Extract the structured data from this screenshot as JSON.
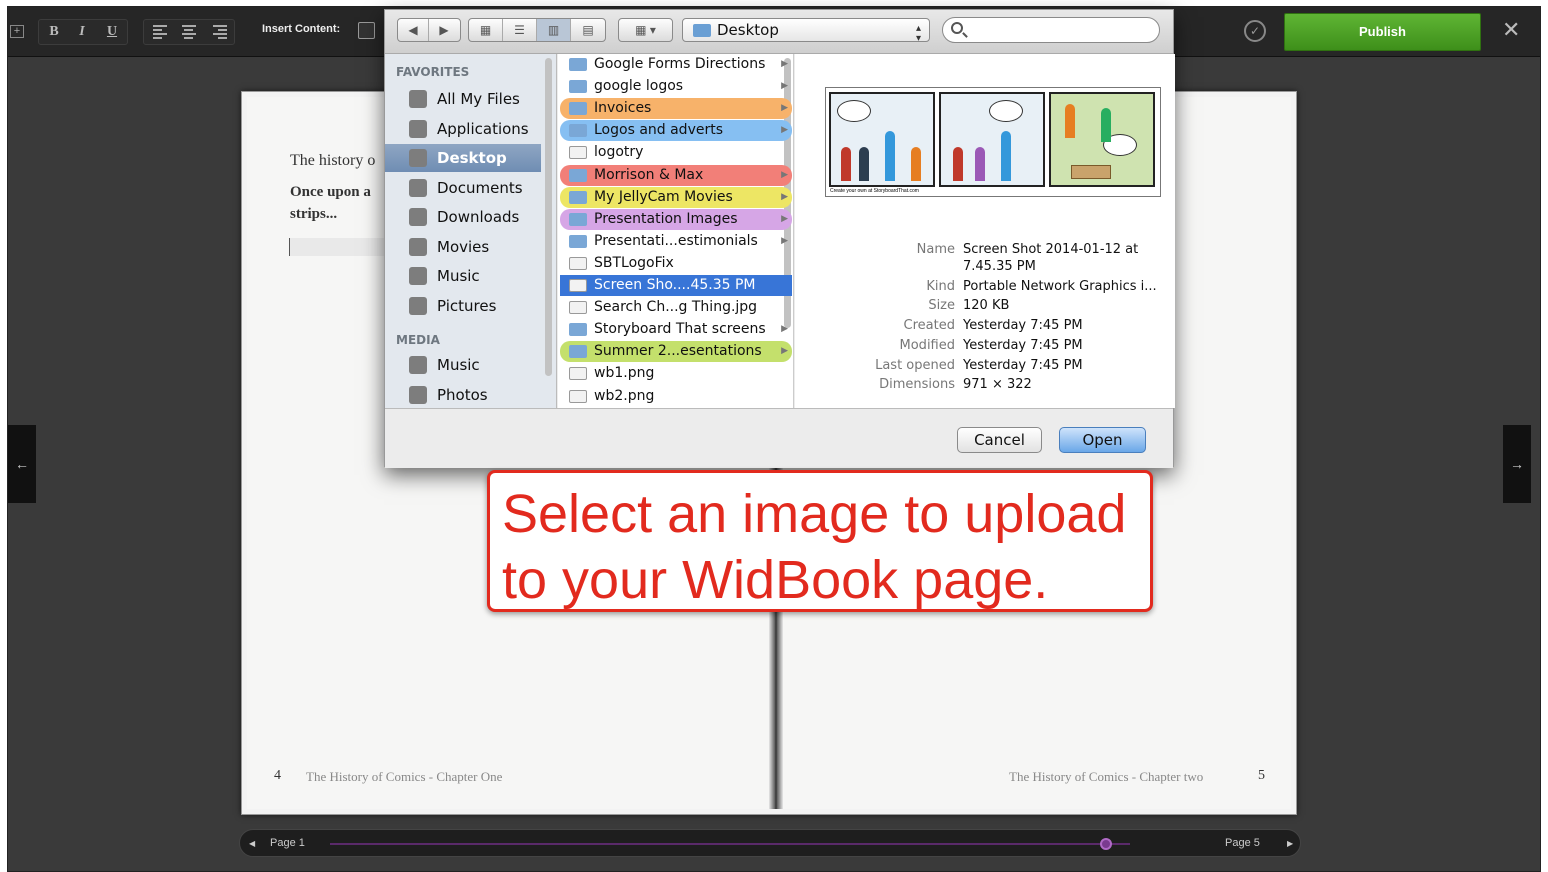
{
  "toolbar": {
    "bold": "B",
    "italic": "I",
    "underline": "U",
    "insert_content_label": "Insert Content:",
    "publish_label": "Publish",
    "close_glyph": "✕",
    "check_glyph": "✓"
  },
  "book": {
    "left_page": {
      "title_partial": "The history o",
      "body_line1": "Once upon a",
      "body_line2": "strips...",
      "page_number": "4",
      "footer": "The History of Comics - Chapter One"
    },
    "right_page": {
      "page_number": "5",
      "footer": "The History of Comics - Chapter two"
    }
  },
  "nav": {
    "prev_glyph": "←",
    "next_glyph": "→"
  },
  "progress": {
    "start_label": "Page 1",
    "end_label": "Page 5",
    "position": 0.97
  },
  "dialog": {
    "location": "Desktop",
    "sidebar": {
      "favorites_header": "FAVORITES",
      "favorites": [
        {
          "label": "All My Files",
          "icon": "all-files-icon"
        },
        {
          "label": "Applications",
          "icon": "applications-icon"
        },
        {
          "label": "Desktop",
          "icon": "desktop-icon",
          "selected": true
        },
        {
          "label": "Documents",
          "icon": "documents-icon"
        },
        {
          "label": "Downloads",
          "icon": "downloads-icon"
        },
        {
          "label": "Movies",
          "icon": "movies-icon"
        },
        {
          "label": "Music",
          "icon": "music-icon"
        },
        {
          "label": "Pictures",
          "icon": "pictures-icon"
        }
      ],
      "media_header": "MEDIA",
      "media": [
        {
          "label": "Music",
          "icon": "music-icon"
        },
        {
          "label": "Photos",
          "icon": "photos-icon"
        }
      ]
    },
    "files": [
      {
        "name": "Google Forms Directions",
        "kind": "folder",
        "tag": "",
        "has_children": true
      },
      {
        "name": "google logos",
        "kind": "folder",
        "tag": "",
        "has_children": true
      },
      {
        "name": "Invoices",
        "kind": "folder",
        "tag": "#f7b26a",
        "has_children": true
      },
      {
        "name": "Logos and adverts",
        "kind": "folder",
        "tag": "#86bff2",
        "has_children": true
      },
      {
        "name": "logotry",
        "kind": "file",
        "tag": "",
        "has_children": false
      },
      {
        "name": "Morrison & Max",
        "kind": "folder",
        "tag": "#f27f78",
        "has_children": true
      },
      {
        "name": "My JellyCam Movies",
        "kind": "folder",
        "tag": "#ede664",
        "has_children": true
      },
      {
        "name": "Presentation Images",
        "kind": "folder",
        "tag": "#d6a6e6",
        "has_children": true
      },
      {
        "name": "Presentati...estimonials",
        "kind": "folder",
        "tag": "",
        "has_children": true
      },
      {
        "name": "SBTLogoFix",
        "kind": "file",
        "tag": "",
        "has_children": false
      },
      {
        "name": "Screen Sho....45.35 PM",
        "kind": "file",
        "tag": "",
        "has_children": false,
        "selected": true
      },
      {
        "name": "Search Ch...g Thing.jpg",
        "kind": "file",
        "tag": "",
        "has_children": false
      },
      {
        "name": "Storyboard That screens",
        "kind": "folder",
        "tag": "",
        "has_children": true
      },
      {
        "name": "Summer 2...esentations",
        "kind": "folder",
        "tag": "#c4e06c",
        "has_children": true
      },
      {
        "name": "wb1.png",
        "kind": "file",
        "tag": "",
        "has_children": false
      },
      {
        "name": "wb2.png",
        "kind": "file",
        "tag": "",
        "has_children": false
      }
    ],
    "preview": {
      "caption": "Create your own at StoryboardThat.com",
      "meta": [
        {
          "key": "Name",
          "value": "Screen Shot 2014-01-12 at",
          "value2": "7.45.35 PM"
        },
        {
          "key": "Kind",
          "value": "Portable Network Graphics i..."
        },
        {
          "key": "Size",
          "value": "120 KB"
        },
        {
          "key": "Created",
          "value": "Yesterday 7:45 PM"
        },
        {
          "key": "Modified",
          "value": "Yesterday 7:45 PM"
        },
        {
          "key": "Last opened",
          "value": "Yesterday 7:45 PM"
        },
        {
          "key": "Dimensions",
          "value": "971 × 322"
        }
      ]
    },
    "cancel_label": "Cancel",
    "open_label": "Open"
  },
  "callout": {
    "text": "Select an image to upload to your WidBook page."
  },
  "colors": {
    "accent_publish": "#4fa428",
    "callout_red": "#e22a1e",
    "selection_blue": "#3875d7"
  }
}
